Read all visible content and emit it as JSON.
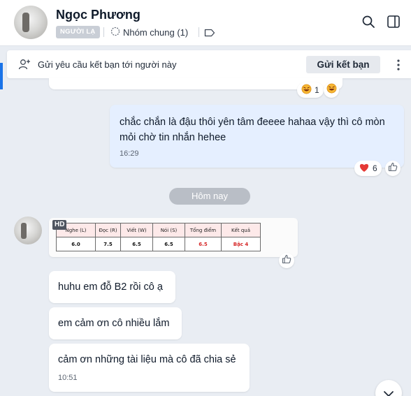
{
  "header": {
    "contact_name": "Ngọc Phương",
    "stranger_badge": "NGƯỜI LẠ",
    "group_label": "Nhóm chung (1)"
  },
  "friend_request": {
    "text": "Gửi yêu cầu kết bạn tới người này",
    "button_label": "Gửi kết bạn"
  },
  "messages": {
    "prev_reactions": {
      "count": "1"
    },
    "sent_1": {
      "text": "chắc chắn là đậu thôi yên tâm đeeee hahaa vậy thì cô mòn mỏi chờ tin nhắn hehee",
      "time": "16:29",
      "reaction_count": "6"
    },
    "date_divider": "Hôm nay",
    "image": {
      "hd_label": "HD",
      "table": {
        "headers": [
          "Nghe (L)",
          "Đọc (R)",
          "Viết (W)",
          "Nói (S)",
          "Tổng điểm",
          "Kết quả"
        ],
        "values": [
          "6.0",
          "7.5",
          "6.5",
          "6.5",
          "6.5",
          "Bậc 4"
        ]
      }
    },
    "recv_1": {
      "text": "huhu em đỗ B2 rồi cô ạ"
    },
    "recv_2": {
      "text": "em cảm ơn cô nhiều lắm"
    },
    "recv_3": {
      "text": "cảm ơn những tài liệu mà cô đã chia sẻ",
      "time": "10:51"
    }
  },
  "icons": {
    "header": [
      "search-icon",
      "sidebar-toggle-icon",
      "group-icon",
      "tag-icon"
    ],
    "friend_request": [
      "add-user-icon",
      "more-options-icon"
    ],
    "reactions": [
      "laughing-emoji-icon",
      "heart-icon",
      "thumbs-up-icon"
    ],
    "scroll": "chevron-down-icon"
  },
  "colors": {
    "accent": "#1a73e8",
    "sent_bubble": "#e5efff",
    "received_bubble": "#ffffff",
    "chat_background": "#e9edf3",
    "score_header_bg": "#fde9e9",
    "score_highlight": "#d62828"
  }
}
